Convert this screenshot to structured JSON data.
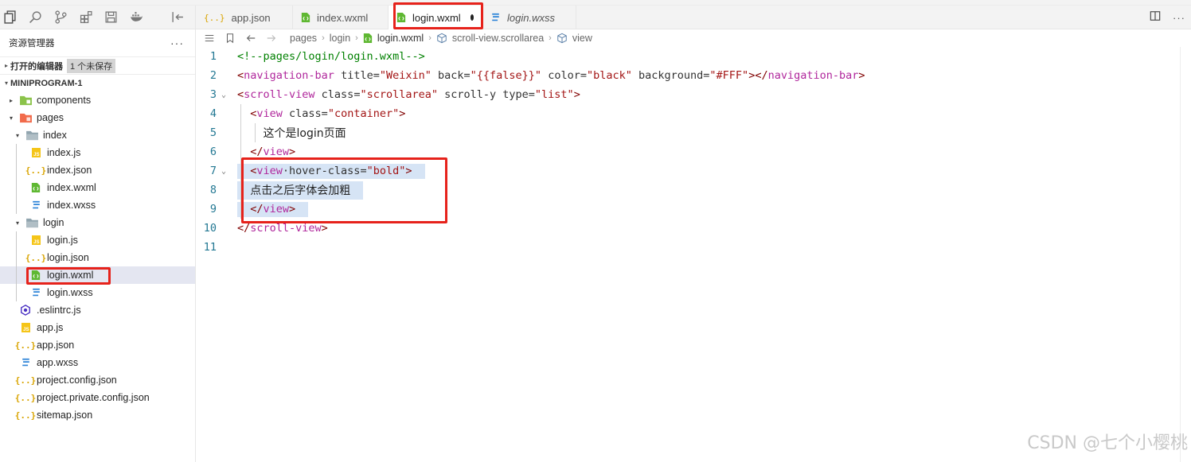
{
  "activity_icons": [
    "files-icon",
    "search-icon",
    "source-control-icon",
    "extensions-icon",
    "storage-icon",
    "docker-icon",
    "collapse-icon"
  ],
  "sidebar": {
    "title": "资源管理器",
    "more": "···",
    "open_editors_label": "打开的编辑器",
    "open_editors_badge": "1 个未保存",
    "project_label": "MINIPROGRAM-1",
    "tree": [
      {
        "label": "components",
        "type": "folder",
        "icon": "folder-components-icon",
        "level": 1,
        "expanded": false
      },
      {
        "label": "pages",
        "type": "folder",
        "icon": "folder-pages-icon",
        "level": 1,
        "expanded": true
      },
      {
        "label": "index",
        "type": "folder",
        "icon": "folder-icon",
        "level": 2,
        "expanded": true
      },
      {
        "label": "index.js",
        "type": "js",
        "level": 3
      },
      {
        "label": "index.json",
        "type": "json",
        "level": 3
      },
      {
        "label": "index.wxml",
        "type": "wxml",
        "level": 3
      },
      {
        "label": "index.wxss",
        "type": "wxss",
        "level": 3
      },
      {
        "label": "login",
        "type": "folder",
        "icon": "folder-icon",
        "level": 2,
        "expanded": true
      },
      {
        "label": "login.js",
        "type": "js",
        "level": 3
      },
      {
        "label": "login.json",
        "type": "json",
        "level": 3
      },
      {
        "label": "login.wxml",
        "type": "wxml",
        "level": 3,
        "selected": true
      },
      {
        "label": "login.wxss",
        "type": "wxss",
        "level": 3
      },
      {
        "label": ".eslintrc.js",
        "type": "eslint",
        "level": 1
      },
      {
        "label": "app.js",
        "type": "js",
        "level": 1
      },
      {
        "label": "app.json",
        "type": "json",
        "level": 1
      },
      {
        "label": "app.wxss",
        "type": "wxss",
        "level": 1
      },
      {
        "label": "project.config.json",
        "type": "json",
        "level": 1
      },
      {
        "label": "project.private.config.json",
        "type": "json",
        "level": 1
      },
      {
        "label": "sitemap.json",
        "type": "json",
        "level": 1
      }
    ]
  },
  "tabs": [
    {
      "label": "app.json",
      "type": "json",
      "active": false,
      "dirty": false,
      "italic": false
    },
    {
      "label": "index.wxml",
      "type": "wxml",
      "active": false,
      "dirty": false,
      "italic": false
    },
    {
      "label": "login.wxml",
      "type": "wxml",
      "active": true,
      "dirty": true,
      "italic": false
    },
    {
      "label": "login.wxss",
      "type": "wxss",
      "active": false,
      "dirty": false,
      "italic": true
    }
  ],
  "breadcrumb": [
    "pages",
    "login",
    "login.wxml",
    "scroll-view.scrollarea",
    "view"
  ],
  "editor": {
    "line_numbers": [
      "1",
      "2",
      "3",
      "4",
      "5",
      "6",
      "7",
      "8",
      "9",
      "10",
      "11"
    ],
    "lines": [
      [
        {
          "t": "<!--pages/login/login.wxml-->",
          "c": "comment"
        }
      ],
      [
        {
          "t": "<",
          "c": "punc"
        },
        {
          "t": "navigation-bar",
          "c": "tagname"
        },
        {
          "t": " title=",
          "c": "attr"
        },
        {
          "t": "\"Weixin\"",
          "c": "str"
        },
        {
          "t": " back=",
          "c": "attr"
        },
        {
          "t": "\"{{false}}\"",
          "c": "str"
        },
        {
          "t": " color=",
          "c": "attr"
        },
        {
          "t": "\"black\"",
          "c": "str"
        },
        {
          "t": " background=",
          "c": "attr"
        },
        {
          "t": "\"#FFF\"",
          "c": "str"
        },
        {
          "t": "></",
          "c": "punc"
        },
        {
          "t": "navigation-bar",
          "c": "tagname"
        },
        {
          "t": ">",
          "c": "punc"
        }
      ],
      [
        {
          "t": "<",
          "c": "punc"
        },
        {
          "t": "scroll-view",
          "c": "tagname"
        },
        {
          "t": " class=",
          "c": "attr"
        },
        {
          "t": "\"scrollarea\"",
          "c": "str"
        },
        {
          "t": " scroll-y type=",
          "c": "attr"
        },
        {
          "t": "\"list\"",
          "c": "str"
        },
        {
          "t": ">",
          "c": "punc"
        }
      ],
      [
        {
          "t": "  <",
          "c": "punc"
        },
        {
          "t": "view",
          "c": "tagname"
        },
        {
          "t": " class=",
          "c": "attr"
        },
        {
          "t": "\"container\"",
          "c": "str"
        },
        {
          "t": ">",
          "c": "punc"
        }
      ],
      [
        {
          "t": "    ",
          "c": "attr"
        },
        {
          "t": "这个是login页面",
          "c": "text"
        }
      ],
      [
        {
          "t": "  </",
          "c": "punc"
        },
        {
          "t": "view",
          "c": "tagname"
        },
        {
          "t": ">",
          "c": "punc"
        }
      ],
      [
        {
          "t": "  <",
          "c": "punc"
        },
        {
          "t": "view",
          "c": "tagname"
        },
        {
          "t": "·hover-class=",
          "c": "attr"
        },
        {
          "t": "\"bold\"",
          "c": "str"
        },
        {
          "t": ">",
          "c": "punc"
        }
      ],
      [
        {
          "t": "  ",
          "c": "attr"
        },
        {
          "t": "点击之后字体会加粗",
          "c": "text"
        }
      ],
      [
        {
          "t": "  </",
          "c": "punc"
        },
        {
          "t": "view",
          "c": "tagname"
        },
        {
          "t": ">",
          "c": "punc"
        }
      ],
      [
        {
          "t": "</",
          "c": "punc"
        },
        {
          "t": "scroll-view",
          "c": "tagname"
        },
        {
          "t": ">",
          "c": "punc"
        }
      ],
      []
    ]
  },
  "watermark": "CSDN @七个小樱桃",
  "colors": {
    "annotation_red": "#e6221b",
    "selection": "#d6e4f5",
    "wxml_green": "#5fb832",
    "json_yellow": "#d9a400",
    "wxss_blue": "#2d84d8"
  }
}
